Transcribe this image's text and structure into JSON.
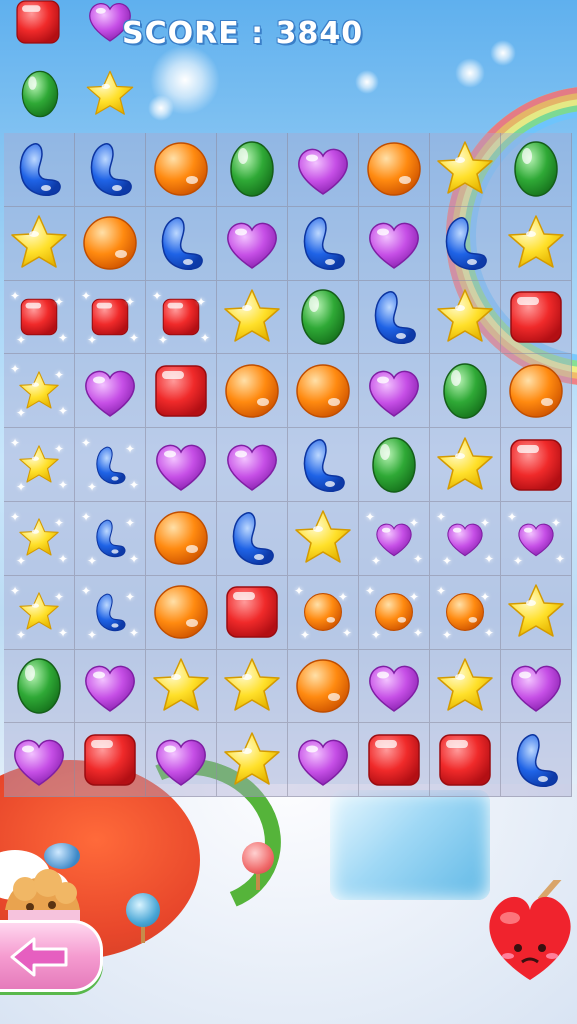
{
  "hud": {
    "score_text": "SCORE : 3840",
    "preview_candies": [
      "red-square",
      "purple-heart",
      "green-oval",
      "yellow-star"
    ]
  },
  "board": {
    "columns": 8,
    "rows": 9,
    "cells": [
      [
        "blue-bean",
        "blue-bean",
        "orange-ball",
        "green-oval",
        "purple-heart",
        "orange-ball",
        "yellow-star",
        "green-oval"
      ],
      [
        "yellow-star",
        "orange-ball",
        "blue-bean",
        "purple-heart",
        "blue-bean",
        "purple-heart",
        "blue-bean",
        "yellow-star"
      ],
      [
        "red-square-small",
        "red-square-small",
        "red-square-small",
        "yellow-star",
        "green-oval",
        "blue-bean",
        "yellow-star",
        "red-square"
      ],
      [
        "yellow-star-small",
        "purple-heart",
        "red-square",
        "orange-ball",
        "orange-ball",
        "purple-heart",
        "green-oval",
        "orange-ball"
      ],
      [
        "yellow-star-small",
        "blue-bean-small",
        "purple-heart",
        "purple-heart",
        "blue-bean",
        "green-oval",
        "yellow-star",
        "red-square"
      ],
      [
        "yellow-star-small",
        "blue-bean-small",
        "orange-ball",
        "blue-bean",
        "yellow-star",
        "purple-heart-small",
        "purple-heart-small",
        "purple-heart-small"
      ],
      [
        "yellow-star-small",
        "blue-bean-small",
        "orange-ball",
        "red-square",
        "orange-ball-small",
        "orange-ball-small",
        "orange-ball-small",
        "yellow-star"
      ],
      [
        "green-oval",
        "purple-heart",
        "yellow-star",
        "yellow-star",
        "orange-ball",
        "purple-heart",
        "yellow-star",
        "purple-heart"
      ],
      [
        "purple-heart",
        "red-square",
        "purple-heart",
        "yellow-star",
        "purple-heart",
        "red-square",
        "red-square",
        "blue-bean"
      ]
    ]
  },
  "controls": {
    "back_icon": "back-arrow-icon"
  },
  "colors": {
    "red": "#f02a2a",
    "purple": "#c64fe6",
    "green": "#2fa936",
    "yellow": "#ffe02a",
    "orange": "#ff8a10",
    "blue": "#1f63e6",
    "score_outline": "#3b7fc8"
  }
}
